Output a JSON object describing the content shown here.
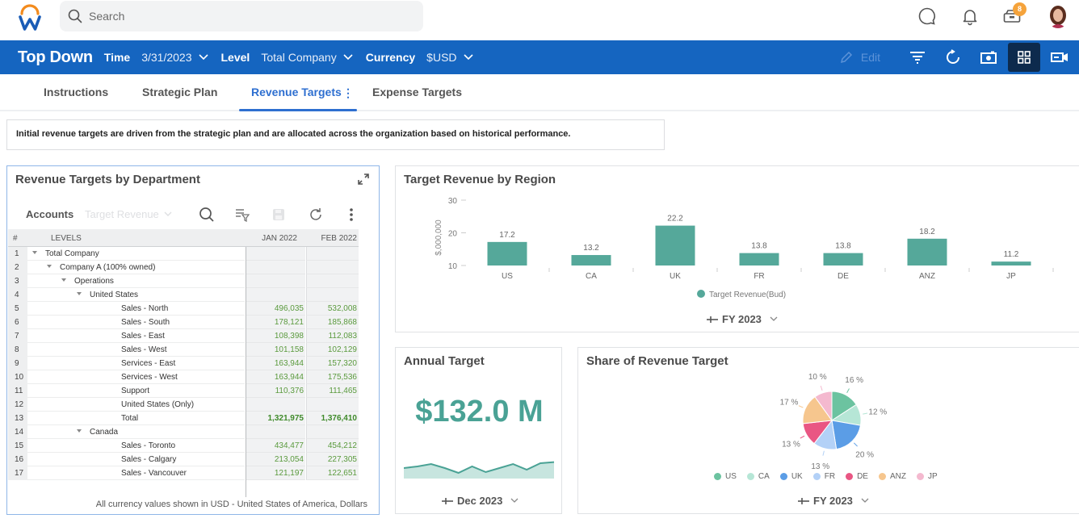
{
  "topbar": {
    "search_placeholder": "Search",
    "inbox_badge": "8",
    "icons": [
      "chat-icon",
      "bell-icon",
      "inbox-icon",
      "avatar"
    ]
  },
  "header": {
    "title": "Top Down",
    "params": [
      {
        "label": "Time",
        "value": "3/31/2023"
      },
      {
        "label": "Level",
        "value": "Total Company"
      },
      {
        "label": "Currency",
        "value": "$USD"
      }
    ],
    "edit_label": "Edit",
    "colors": {
      "bar": "#1565c0",
      "active_icon_bg": "#0d2a4d"
    }
  },
  "tabs": [
    {
      "label": "Instructions",
      "active": false
    },
    {
      "label": "Strategic Plan",
      "active": false
    },
    {
      "label": "Revenue Targets",
      "active": true
    },
    {
      "label": "Expense Targets",
      "active": false
    }
  ],
  "instruction_text": "Initial revenue targets are driven from the strategic plan and are allocated across the organization based on historical performance.",
  "grid_card": {
    "title": "Revenue Targets by Department",
    "toolbar": {
      "label": "Accounts",
      "select_value": "Target Revenue"
    },
    "columns": {
      "num": "#",
      "levels": "LEVELS",
      "c1": "JAN 2022",
      "c2": "FEB 2022"
    },
    "rows": [
      {
        "n": "1",
        "label": "Total Company",
        "indent": 0,
        "expand": true,
        "c1": "",
        "c2": ""
      },
      {
        "n": "2",
        "label": "Company A (100% owned)",
        "indent": 1,
        "expand": true,
        "c1": "",
        "c2": ""
      },
      {
        "n": "3",
        "label": "Operations",
        "indent": 2,
        "expand": true,
        "c1": "",
        "c2": ""
      },
      {
        "n": "4",
        "label": "United States",
        "indent": 3,
        "expand": true,
        "c1": "",
        "c2": ""
      },
      {
        "n": "5",
        "label": "Sales - North",
        "indent": 4,
        "expand": false,
        "c1": "496,035",
        "c2": "532,008"
      },
      {
        "n": "6",
        "label": "Sales - South",
        "indent": 4,
        "expand": false,
        "c1": "178,121",
        "c2": "185,868"
      },
      {
        "n": "7",
        "label": "Sales - East",
        "indent": 4,
        "expand": false,
        "c1": "108,398",
        "c2": "112,083"
      },
      {
        "n": "8",
        "label": "Sales - West",
        "indent": 4,
        "expand": false,
        "c1": "101,158",
        "c2": "102,129"
      },
      {
        "n": "9",
        "label": "Services - East",
        "indent": 4,
        "expand": false,
        "c1": "163,944",
        "c2": "157,320"
      },
      {
        "n": "10",
        "label": "Services - West",
        "indent": 4,
        "expand": false,
        "c1": "163,944",
        "c2": "175,536"
      },
      {
        "n": "11",
        "label": "Support",
        "indent": 4,
        "expand": false,
        "c1": "110,376",
        "c2": "111,465"
      },
      {
        "n": "12",
        "label": "United States (Only)",
        "indent": 4,
        "expand": false,
        "c1": "",
        "c2": ""
      },
      {
        "n": "13",
        "label": "Total",
        "indent": 4,
        "expand": false,
        "c1": "1,321,975",
        "c2": "1,376,410",
        "bold": true
      },
      {
        "n": "14",
        "label": "Canada",
        "indent": 3,
        "expand": true,
        "c1": "",
        "c2": ""
      },
      {
        "n": "15",
        "label": "Sales - Toronto",
        "indent": 4,
        "expand": false,
        "c1": "434,477",
        "c2": "454,212"
      },
      {
        "n": "16",
        "label": "Sales - Calgary",
        "indent": 4,
        "expand": false,
        "c1": "213,054",
        "c2": "227,305"
      },
      {
        "n": "17",
        "label": "Sales - Vancouver",
        "indent": 4,
        "expand": false,
        "c1": "121,197",
        "c2": "122,651"
      }
    ],
    "footer": "All currency values shown in USD - United States of America, Dollars"
  },
  "region_card": {
    "period": "FY 2023"
  },
  "annual_card": {
    "title": "Annual Target",
    "value": "$132.0 M",
    "period": "Dec 2023",
    "sparkline_trend": [
      0.45,
      0.55,
      0.7,
      0.45,
      0.15,
      0.55,
      0.2,
      0.45,
      0.7,
      0.35,
      0.75,
      0.82
    ]
  },
  "share_card": {
    "period": "FY 2023"
  },
  "chart_data": [
    {
      "type": "bar",
      "title": "Target Revenue by Region",
      "categories": [
        "US",
        "CA",
        "UK",
        "FR",
        "DE",
        "ANZ",
        "JP"
      ],
      "values": [
        17.2,
        13.2,
        22.2,
        13.8,
        13.8,
        18.2,
        11.2
      ],
      "value_labels": [
        "17.2",
        "13.2",
        "22.2",
        "13.8",
        "13.8",
        "18.2",
        "11.2"
      ],
      "xlabel": "",
      "ylabel": "$,000,000",
      "ylim": [
        10,
        30
      ],
      "yticks": [
        "10",
        "20",
        "30"
      ],
      "legend": [
        "Target Revenue(Bud)"
      ],
      "legend_position": "bottom",
      "color": "#55a89a"
    },
    {
      "type": "pie",
      "title": "Share of Revenue Target",
      "categories": [
        "US",
        "CA",
        "UK",
        "FR",
        "DE",
        "ANZ",
        "JP"
      ],
      "values": [
        16,
        12,
        20,
        13,
        13,
        17,
        10
      ],
      "value_labels": [
        "16 %",
        "12 %",
        "20 %",
        "13 %",
        "13 %",
        "17 %",
        "10 %"
      ],
      "colors": [
        "#6cc3a0",
        "#b6e6d6",
        "#5b9de6",
        "#b3d1f7",
        "#e95683",
        "#f6c68e",
        "#f4b9cf"
      ],
      "legend_position": "bottom"
    }
  ]
}
